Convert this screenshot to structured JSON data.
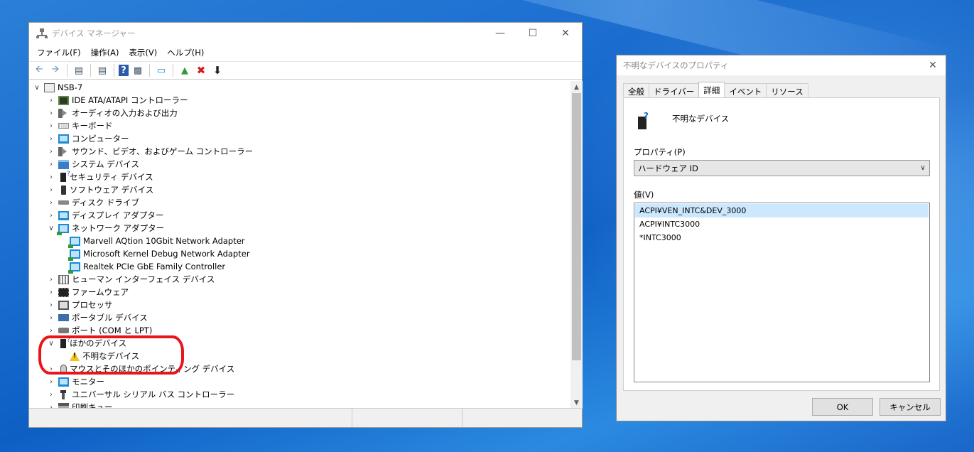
{
  "device_manager": {
    "title": "デバイス マネージャー",
    "menu": [
      "ファイル(F)",
      "操作(A)",
      "表示(V)",
      "ヘルプ(H)"
    ],
    "toolbar": [
      "back-icon",
      "forward-icon",
      "properties-icon",
      "list-icon",
      "help-icon",
      "view-icon",
      "monitor-icon",
      "update-driver-icon",
      "uninstall-icon",
      "disable-icon"
    ],
    "root": "NSB-7",
    "tree": [
      {
        "label": "IDE ATA/ATAPI コントローラー",
        "icon": "chip",
        "level": 1,
        "expanded": false
      },
      {
        "label": "オーディオの入力および出力",
        "icon": "spk",
        "level": 1,
        "expanded": false
      },
      {
        "label": "キーボード",
        "icon": "kbd",
        "level": 1,
        "expanded": false
      },
      {
        "label": "コンピューター",
        "icon": "mon",
        "level": 1,
        "expanded": false
      },
      {
        "label": "サウンド、ビデオ、およびゲーム コントローラー",
        "icon": "spk",
        "level": 1,
        "expanded": false
      },
      {
        "label": "システム デバイス",
        "icon": "folder",
        "level": 1,
        "expanded": false
      },
      {
        "label": "セキュリティ デバイス",
        "icon": "dev",
        "level": 1,
        "expanded": false
      },
      {
        "label": "ソフトウェア デバイス",
        "icon": "phone",
        "level": 1,
        "expanded": false
      },
      {
        "label": "ディスク ドライブ",
        "icon": "disk",
        "level": 1,
        "expanded": false
      },
      {
        "label": "ディスプレイ アダプター",
        "icon": "mon",
        "level": 1,
        "expanded": false
      },
      {
        "label": "ネットワーク アダプター",
        "icon": "net",
        "level": 1,
        "expanded": true
      },
      {
        "label": "Marvell AQtion 10Gbit Network Adapter",
        "icon": "net",
        "level": 2
      },
      {
        "label": "Microsoft Kernel Debug Network Adapter",
        "icon": "net",
        "level": 2
      },
      {
        "label": "Realtek PCIe GbE Family Controller",
        "icon": "net",
        "level": 2
      },
      {
        "label": "ヒューマン インターフェイス デバイス",
        "icon": "hid",
        "level": 1,
        "expanded": false
      },
      {
        "label": "ファームウェア",
        "icon": "fw",
        "level": 1,
        "expanded": false
      },
      {
        "label": "プロセッサ",
        "icon": "cpu",
        "level": 1,
        "expanded": false
      },
      {
        "label": "ポータブル デバイス",
        "icon": "port",
        "level": 1,
        "expanded": false
      },
      {
        "label": "ポート (COM と LPT)",
        "icon": "portc",
        "level": 1,
        "expanded": false
      },
      {
        "label": "ほかのデバイス",
        "icon": "dev",
        "level": 1,
        "expanded": true
      },
      {
        "label": "不明なデバイス",
        "icon": "warn",
        "level": 2
      },
      {
        "label": "マウスとそのほかのポインティング デバイス",
        "icon": "mouse",
        "level": 1,
        "expanded": false
      },
      {
        "label": "モニター",
        "icon": "mon",
        "level": 1,
        "expanded": false
      },
      {
        "label": "ユニバーサル シリアル バス コントローラー",
        "icon": "usb",
        "level": 1,
        "expanded": false
      },
      {
        "label": "印刷キュー",
        "icon": "print",
        "level": 1,
        "expanded": false
      }
    ]
  },
  "properties_dialog": {
    "title": "不明なデバイスのプロパティ",
    "tabs": [
      "全般",
      "ドライバー",
      "詳細",
      "イベント",
      "リソース"
    ],
    "active_tab": "詳細",
    "device_name": "不明なデバイス",
    "property_label": "プロパティ(P)",
    "property_selected": "ハードウェア ID",
    "value_label": "値(V)",
    "values": [
      "ACPI¥VEN_INTC&DEV_3000",
      "ACPI¥INTC3000",
      "*INTC3000"
    ],
    "selected_value_index": 0,
    "ok_label": "OK",
    "cancel_label": "キャンセル"
  },
  "colors": {
    "annotation_circle": "#e8151a",
    "selection": "#cce8ff",
    "desktop": "#1c6fd0"
  }
}
